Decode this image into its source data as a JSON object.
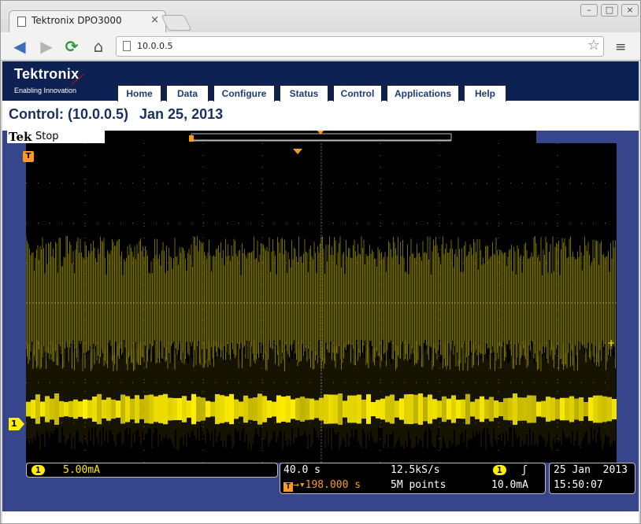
{
  "browser": {
    "tab_title": "Tektronix DPO3000",
    "url": "10.0.0.5"
  },
  "header": {
    "brand": "Tektronix",
    "tagline": "Enabling Innovation",
    "nav": [
      "Home",
      "Data",
      "Configure",
      "Status",
      "Control",
      "Applications",
      "Help"
    ]
  },
  "title": {
    "prefix": "Control: (10.0.0.5)",
    "date": "Jan 25, 2013"
  },
  "scope": {
    "brand": "Tek",
    "state": "Stop",
    "trigger_marker": "T",
    "channel_marker": "1",
    "channel": {
      "badge": "1",
      "scale": "5.00mA"
    },
    "horizontal": {
      "scale": "40.0 s",
      "position": "198.000 s",
      "sample_rate": "12.5kS/s",
      "record_length": "5M points"
    },
    "trigger": {
      "source_badge": "1",
      "slope": "ʃ",
      "level": "10.0mA"
    },
    "datetime": {
      "date": "25 Jan  2013",
      "time": "15:50:07"
    }
  },
  "colors": {
    "header_bg": "#0d2152",
    "panel_bg": "#36458c",
    "trace": "#ffee00",
    "marker": "#ff9a1e"
  }
}
